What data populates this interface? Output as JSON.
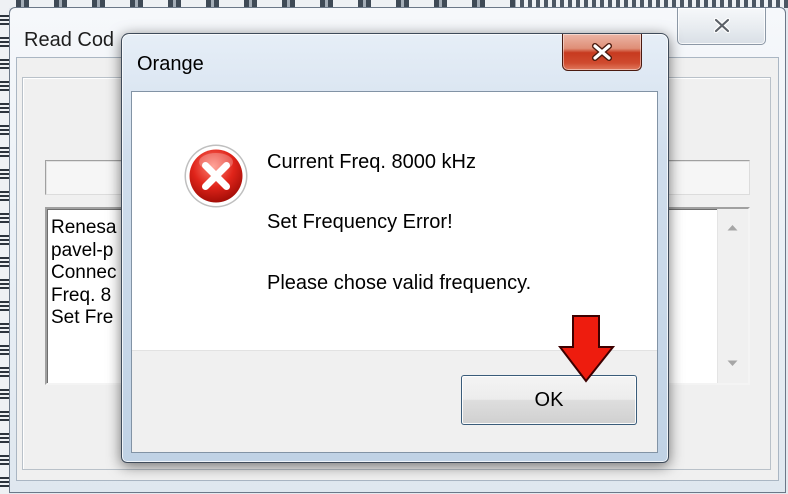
{
  "back_window": {
    "title": "Read Cod",
    "close_icon": "close-icon",
    "log_lines": [
      "Renesa",
      "pavel-p",
      "Connec",
      "Freq. 8",
      "Set Fre"
    ],
    "scroll_up_icon": "scroll-up-icon",
    "scroll_down_icon": "scroll-down-icon"
  },
  "dialog": {
    "title": "Orange",
    "close_icon": "close-icon",
    "status_icon": "error-icon",
    "messages": [
      "Current Freq. 8000 kHz",
      "Set Frequency Error!",
      "Please chose valid frequency."
    ],
    "ok_label": "OK"
  },
  "annotation": {
    "icon": "arrow-down-icon"
  },
  "colors": {
    "dialog_close": "#c73a1f",
    "error_icon": "#e0241a",
    "annotation_arrow": "#ee1c0e",
    "ok_button_border": "#3a5c7a"
  }
}
